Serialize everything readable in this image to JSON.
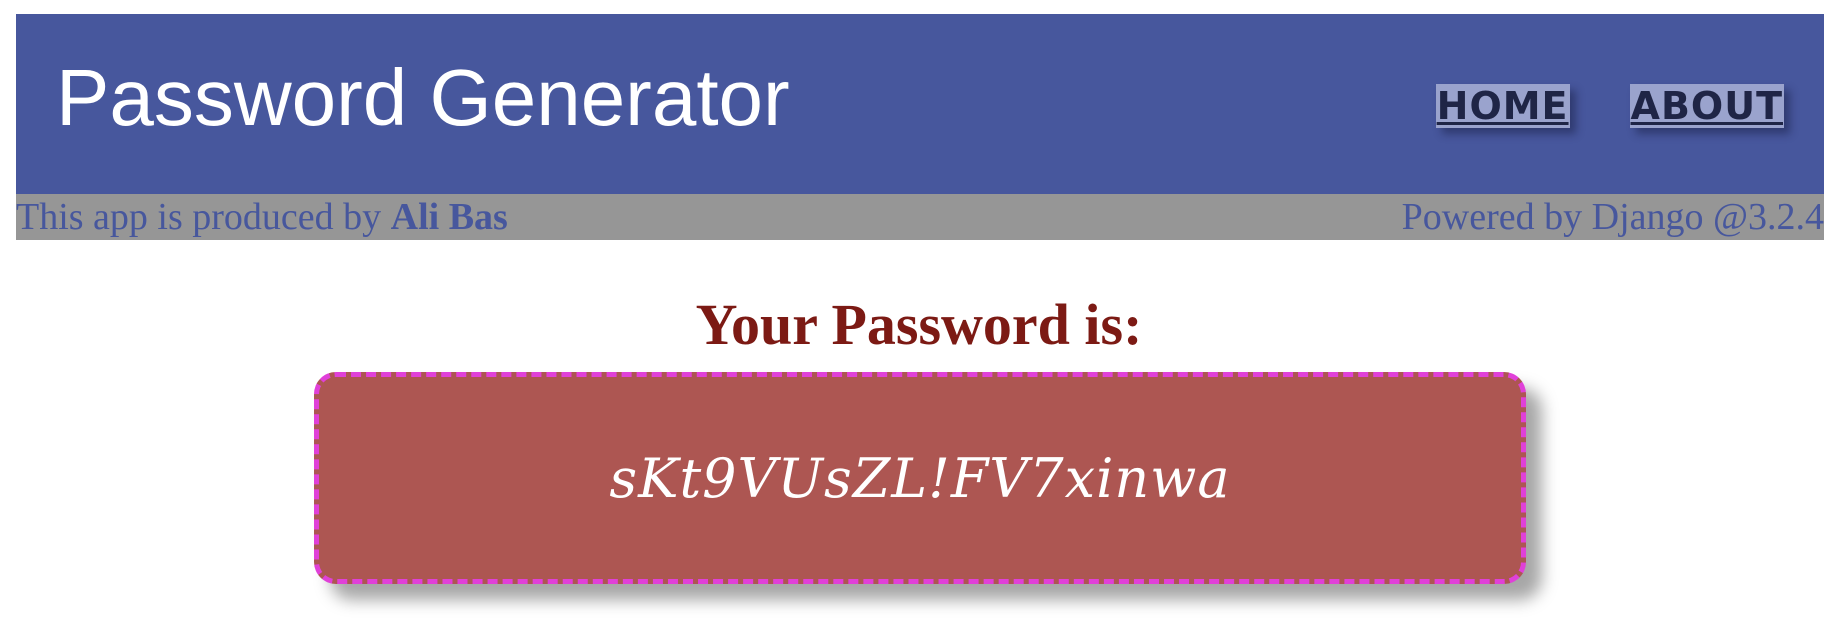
{
  "header": {
    "title": "Password Generator",
    "nav": [
      {
        "label": "HOME"
      },
      {
        "label": "ABOUT"
      }
    ]
  },
  "credit_bar": {
    "produced_by_prefix": "This app is produced by ",
    "author": "Ali Bas",
    "powered_by": "Powered by Django @3.2.4"
  },
  "main": {
    "heading": "Your Password is:",
    "password": "sKt9VUsZL!FV7xinwa"
  },
  "colors": {
    "header_bg": "#47579d",
    "credit_bar_bg": "#969696",
    "credit_text": "#47579d",
    "heading_text": "#7c1a14",
    "password_box_bg": "#ad5652",
    "password_box_border": "#e040d8",
    "nav_link_bg": "#9aa3cd"
  }
}
